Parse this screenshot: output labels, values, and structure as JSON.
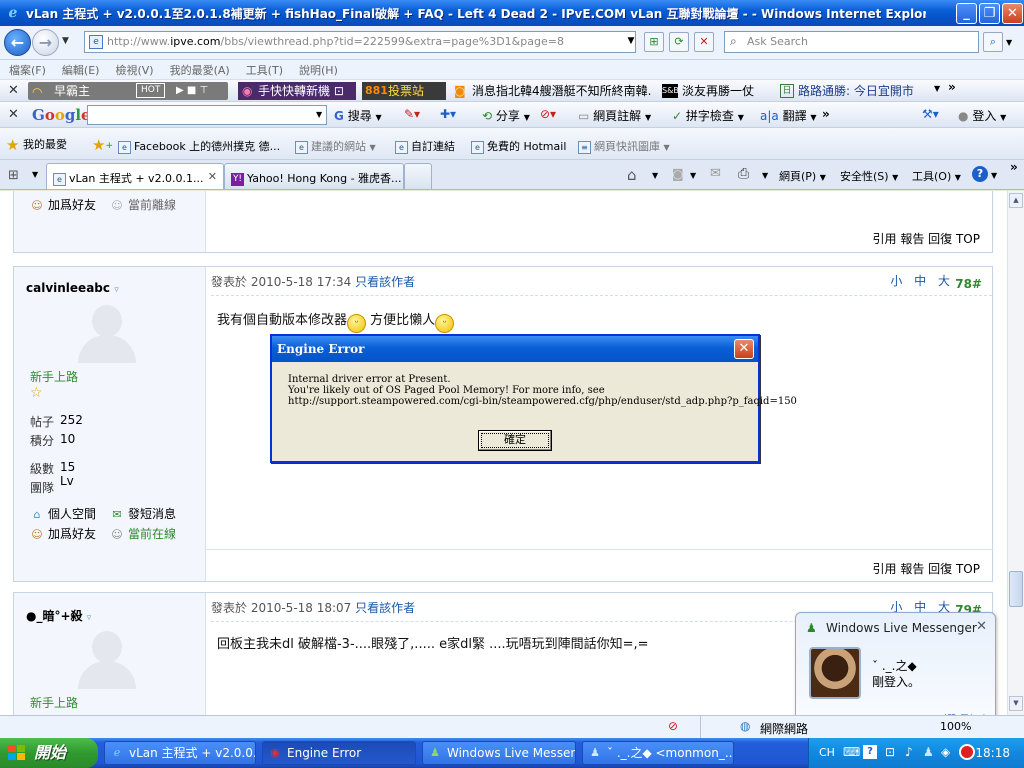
{
  "window": {
    "title": "vLan 主程式 + v2.0.0.1至2.0.1.8補更新 + fishHao_Final破解 + FAQ - Left 4 Dead 2 - IPvE.COM vLan 互聯對戰論壇 - - Windows Internet Explorer",
    "minimize": "_",
    "maximize": "❐",
    "close": "✕"
  },
  "address": {
    "url_prefix": "http://www.",
    "url_domain": "ipve.com",
    "url_rest": "/bbs/viewthread.php?tid=222599&extra=page%3D1&page=8",
    "search_placeholder": "Ask Search"
  },
  "menu": {
    "items": [
      "檔案(F)",
      "編輯(E)",
      "檢視(V)",
      "我的最愛(A)",
      "工具(T)",
      "說明(H)"
    ]
  },
  "toolbar1": {
    "items": [
      "早霸主",
      "HOT",
      "手快快轉新機 ⊡",
      "投票站",
      "消息指北韓4艘潛艇不知所終南韓...",
      "淡友再勝一仗",
      "路路通勝: 今日宜開市"
    ]
  },
  "google_toolbar": {
    "logo": "Google",
    "items": [
      "搜尋",
      "分享",
      "網頁註解",
      "拼字檢查",
      "翻譯",
      "登入"
    ]
  },
  "favorites": {
    "label": "我的最愛",
    "items": [
      "Facebook 上的德州撲克 德...",
      "建議的網站",
      "自訂連結",
      "免費的 Hotmail",
      "網頁快訊圖庫"
    ]
  },
  "tabs": [
    {
      "label": "vLan 主程式 + v2.0.0.1..."
    },
    {
      "label": "Yahoo! Hong Kong - 雅虎香..."
    }
  ],
  "ie_commands": {
    "page": "網頁(P)",
    "safety": "安全性(S)",
    "tools": "工具(O)"
  },
  "top_post_tail": {
    "add_friend": "加爲好友",
    "offline": "當前離線",
    "footer": "引用 報告 回復 TOP"
  },
  "posts": [
    {
      "username": "calvinleeabc",
      "posted_at": "發表於 2010-5-18 17:34",
      "only_author": "只看該作者",
      "font_size": "小 中 大",
      "floor": "78#",
      "rank": "新手上路",
      "stats": [
        {
          "label": "帖子",
          "value": "252"
        },
        {
          "label": "積分",
          "value": "10"
        },
        {
          "label": "級數",
          "value": "15 Lv"
        },
        {
          "label": "團隊",
          "value": ""
        }
      ],
      "space": "個人空間",
      "sms": "發短消息",
      "add_friend": "加爲好友",
      "online": "當前在線",
      "message_a": "我有個自動版本修改器",
      "message_b": "方便比懶人",
      "footer": "引用 報告 回復 TOP"
    },
    {
      "username": "●_暗°+殺",
      "posted_at": "發表於 2010-5-18 18:07",
      "only_author": "只看該作者",
      "font_size": "小 中 大",
      "floor": "79#",
      "rank": "新手上路",
      "message": "回板主我未dl 破解檔-3-....眼殘了,..... e家dl緊 ....玩唔玩到陣間話你知=,="
    }
  ],
  "dialog": {
    "title": "Engine Error",
    "line1": "Internal driver error at Present.",
    "line2": "You're likely out of OS Paged Pool Memory! For more info, see",
    "line3": "http://support.steampowered.com/cgi-bin/steampowered.cfg/php/enduser/std_adp.php?p_faqid=150",
    "ok": "確定"
  },
  "messenger": {
    "title": "Windows Live Messenger",
    "name": "ˇ ._.之◆",
    "status": "剛登入。",
    "options": "選項(O)"
  },
  "statusbar": {
    "zone": "網際網路",
    "zoom": "100%"
  },
  "taskbar": {
    "start": "開始",
    "tasks": [
      {
        "label": "vLan 主程式 + v2.0.0..."
      },
      {
        "label": "Engine Error"
      },
      {
        "label": "Windows Live Messen..."
      },
      {
        "label": "ˇ ._.之◆ <monmon_..."
      }
    ],
    "lang": "CH",
    "clock": "18:18"
  },
  "colors": {
    "xp_blue": "#0a5fd6",
    "link_blue": "#1b58a8",
    "rank_green": "#2f8a2f"
  }
}
